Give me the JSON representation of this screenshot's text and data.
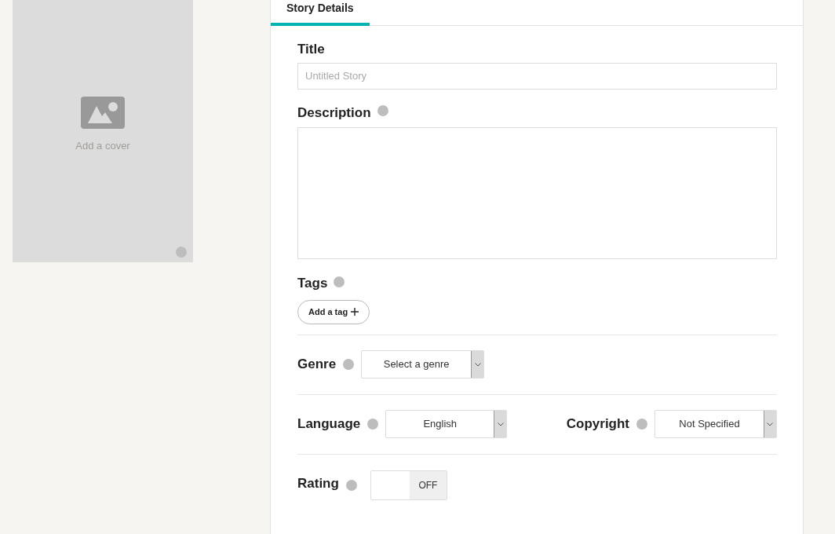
{
  "cover": {
    "label": "Add a cover"
  },
  "tabs": [
    {
      "label": "Story Details",
      "selected": true
    }
  ],
  "title": {
    "label": "Title",
    "placeholder": "Untitled Story"
  },
  "description": {
    "label": "Description"
  },
  "tags": {
    "label": "Tags",
    "button": "Add a tag"
  },
  "genre": {
    "label": "Genre",
    "value": "Select a genre"
  },
  "language": {
    "label": "Language",
    "value": "English"
  },
  "copyright": {
    "label": "Copyright",
    "value": "Not Specified"
  },
  "rating": {
    "label": "Rating",
    "on": false,
    "state_label": "OFF"
  }
}
